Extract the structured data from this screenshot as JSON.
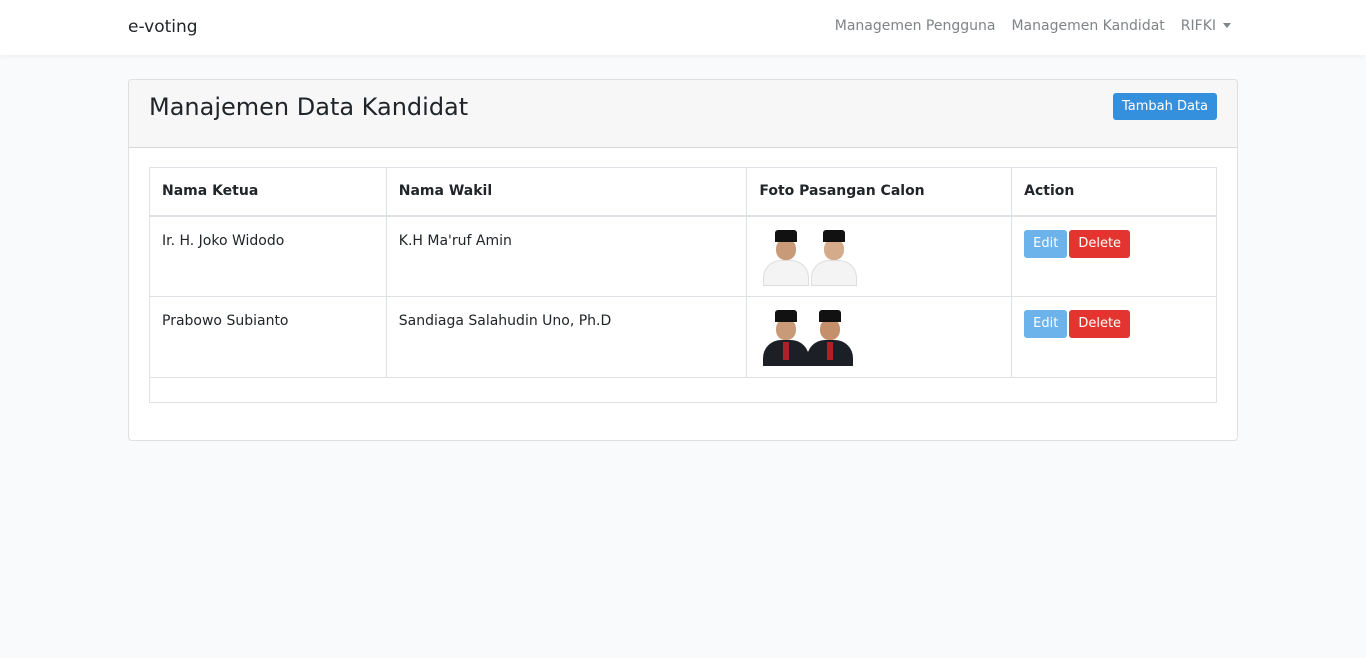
{
  "navbar": {
    "brand": "e-voting",
    "links": [
      "Managemen Pengguna",
      "Managemen Kandidat"
    ],
    "user": "RIFKI"
  },
  "card": {
    "title": "Manajemen Data Kandidat",
    "add_button": "Tambah Data"
  },
  "table": {
    "headers": [
      "Nama Ketua",
      "Nama Wakil",
      "Foto Pasangan Calon",
      "Action"
    ],
    "rows": [
      {
        "ketua": "Ir. H. Joko Widodo",
        "wakil": "K.H Ma'ruf Amin",
        "edit": "Edit",
        "delete": "Delete"
      },
      {
        "ketua": "Prabowo Subianto",
        "wakil": "Sandiaga Salahudin Uno, Ph.D",
        "edit": "Edit",
        "delete": "Delete"
      }
    ]
  },
  "colors": {
    "primary": "#3490dc",
    "info": "#6cb2eb",
    "danger": "#e3342f"
  }
}
